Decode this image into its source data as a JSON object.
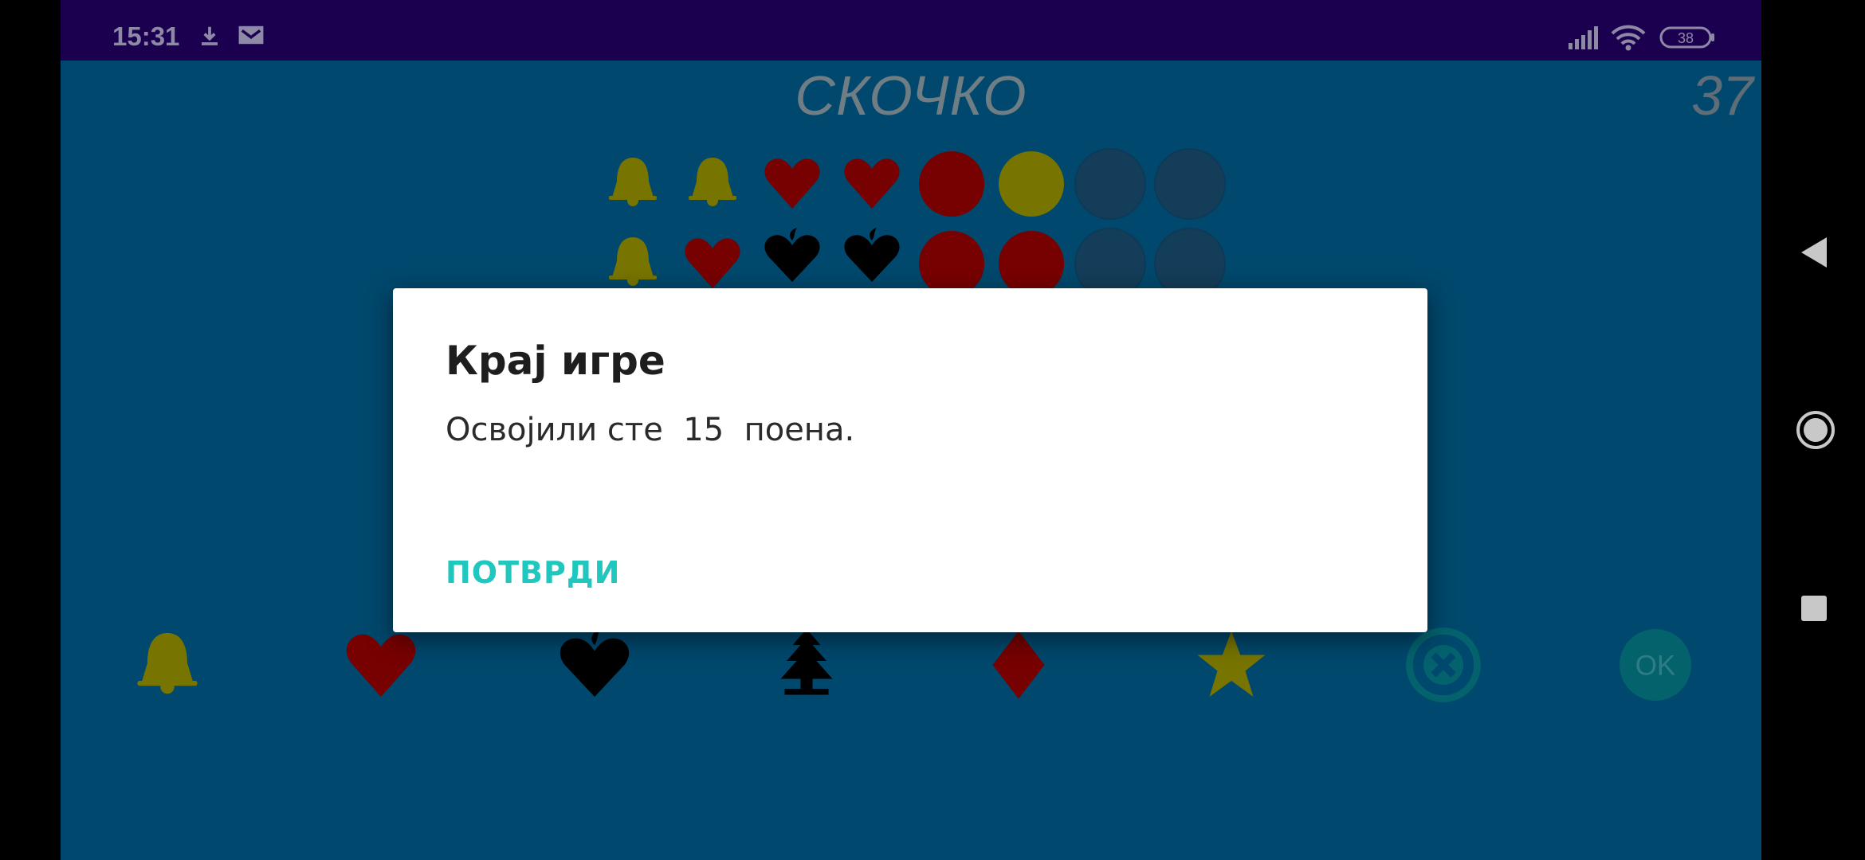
{
  "status_bar": {
    "time": "15:31",
    "battery": "38",
    "icons": [
      "download-icon",
      "mail-icon",
      "signal-icon",
      "wifi-icon",
      "battery-icon"
    ]
  },
  "game": {
    "title": "СКОЧКО",
    "timer": "37",
    "rows": [
      [
        "bell",
        "bell",
        "heart",
        "heart",
        "red",
        "yellow",
        "empty",
        "empty"
      ],
      [
        "bell",
        "heart",
        "spade",
        "spade",
        "red",
        "red",
        "empty",
        "empty"
      ]
    ],
    "pickers": [
      "bell-icon",
      "heart-icon",
      "spade-icon",
      "tree-icon",
      "diamond-icon",
      "star-icon",
      "clear-icon",
      "ok-button"
    ],
    "ok_label": "OK"
  },
  "dialog": {
    "title": "Крај игре",
    "message": "Освојили сте  15  поена.",
    "confirm_label": "ПОТВРДИ"
  },
  "nav_bar": {
    "buttons": [
      "back-icon",
      "home-icon",
      "recents-icon"
    ]
  },
  "colors": {
    "background": "#00486d",
    "status_bar": "#1b0050",
    "yellow_symbol": "#777400",
    "red_symbol": "#770000",
    "black_symbol": "#000000",
    "accent": "#1fc7be"
  }
}
